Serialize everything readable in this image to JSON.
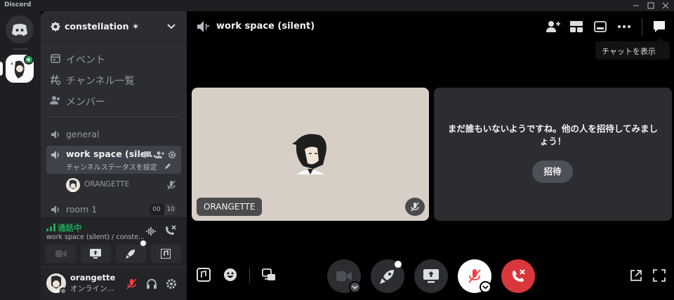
{
  "window": {
    "app_title": "Discord",
    "controls": [
      "minimize",
      "maximize",
      "close"
    ]
  },
  "guild": {
    "name": "constellation ✶",
    "nav": [
      {
        "label": "イベント",
        "icon": "calendar-icon"
      },
      {
        "label": "チャンネル一覧",
        "icon": "channel-browser-icon"
      },
      {
        "label": "メンバー",
        "icon": "members-icon"
      }
    ]
  },
  "channels": [
    {
      "name": "general",
      "icon": "voice-channel-icon"
    },
    {
      "name": "work space (sile...",
      "icon": "voice-channel-icon",
      "active": true,
      "status": "チャンネルステータスを設定"
    },
    {
      "name": "room 1",
      "icon": "voice-channel-icon",
      "counts": [
        "00",
        "10"
      ]
    }
  ],
  "channel_members": [
    {
      "name": "ORANGETTE"
    }
  ],
  "voice_connection": {
    "status": "通話中",
    "subtitle": "work space (silent) / conste..."
  },
  "user": {
    "name": "orangette",
    "status": "オンライン..."
  },
  "call": {
    "title": "work space (silent)",
    "tooltip": "チャットを表示",
    "participant": "ORANGETTE",
    "empty_message": "まだ誰もいないようですね。他の人を招待してみましょう！",
    "invite_label": "招待"
  },
  "colors": {
    "connected_green": "#23a559",
    "hangup_red": "#da373c",
    "active_channel_bg": "#404249"
  }
}
